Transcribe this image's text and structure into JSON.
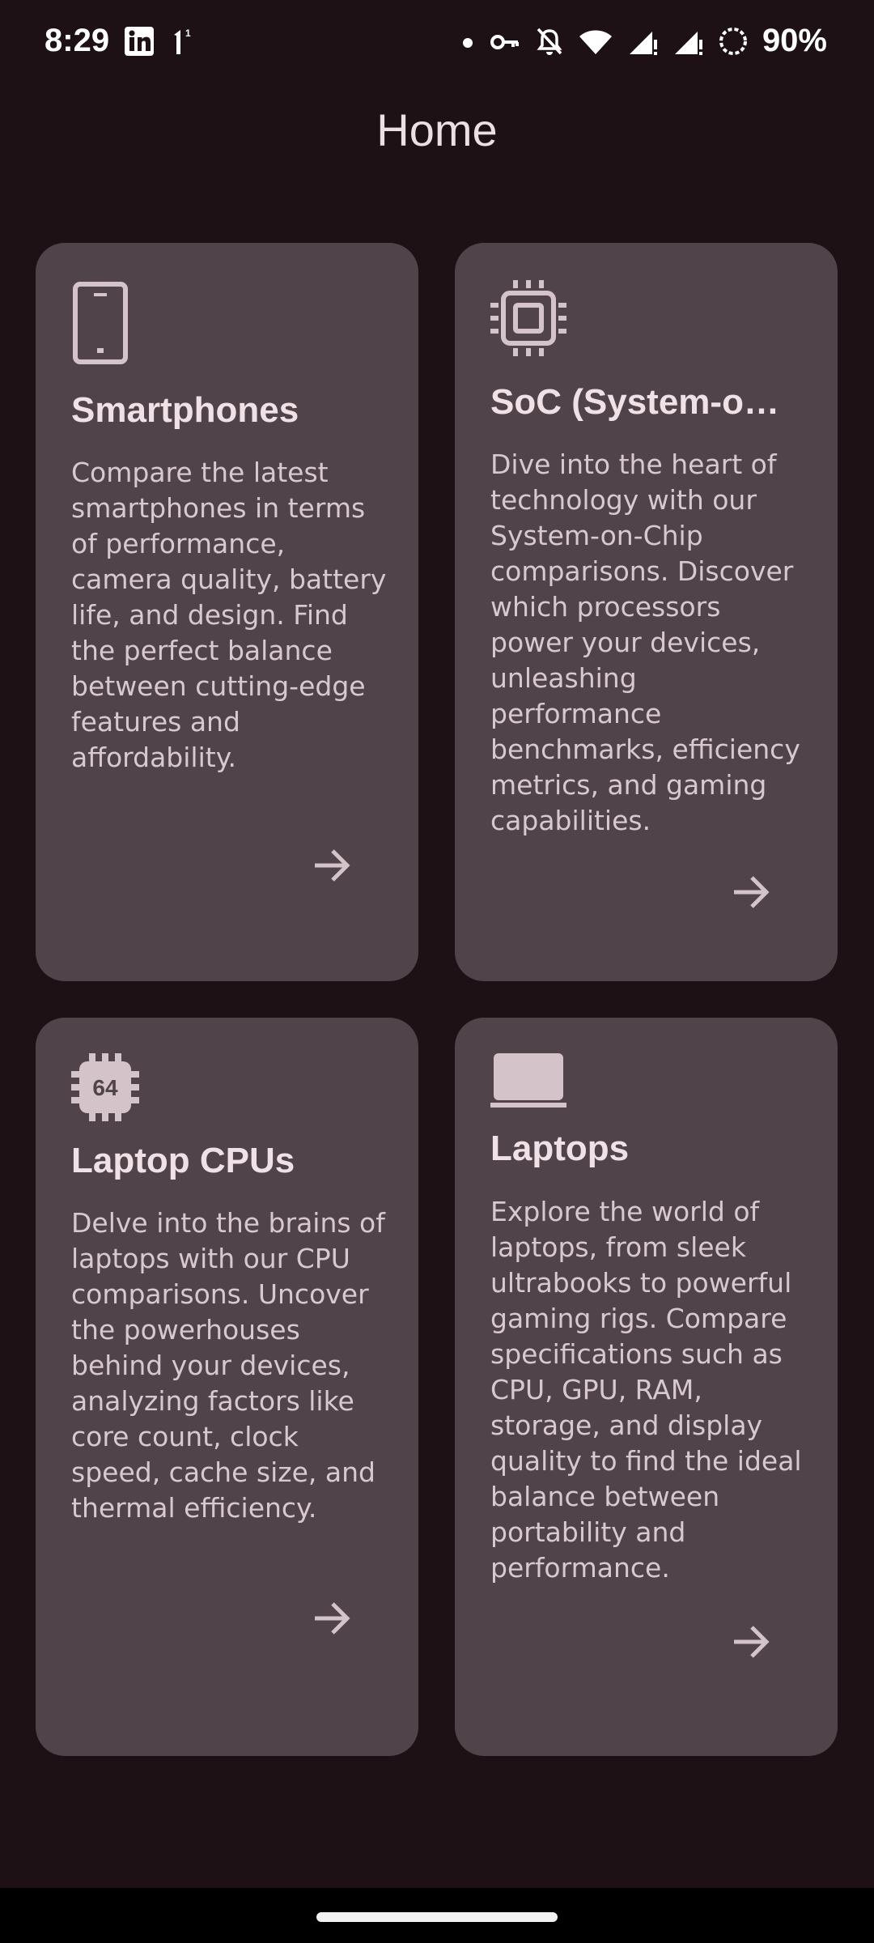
{
  "status_bar": {
    "time": "8:29",
    "notification_count": "1",
    "battery_percent": "90%"
  },
  "header": {
    "title": "Home"
  },
  "cards": [
    {
      "icon": "smartphone-icon",
      "title": "Smartphones",
      "description": "Compare the latest smartphones in terms of performance, camera quality, battery life, and design. Find the perfect balance between cutting-edge features and affordability."
    },
    {
      "icon": "chip-icon",
      "title": "SoC (System-o…",
      "description": "Dive into the heart of technology with our System-on-Chip comparisons. Discover which processors power your devices, unleashing performance benchmarks, efficiency metrics, and gaming capabilities."
    },
    {
      "icon": "cpu-64-icon",
      "title": "Laptop CPUs",
      "description": "Delve into the brains of laptops with our CPU comparisons. Uncover the powerhouses behind your devices, analyzing factors like core count, clock speed, cache size, and thermal efficiency."
    },
    {
      "icon": "laptop-icon",
      "title": "Laptops",
      "description": "Explore the world of laptops, from sleek ultrabooks to powerful gaming rigs. Compare specifications such as CPU, GPU, RAM, storage, and display quality to find the ideal balance between portability and performance."
    }
  ],
  "colors": {
    "background": "#1d1115",
    "card": "#51434a",
    "text": "#ecdfe3"
  }
}
